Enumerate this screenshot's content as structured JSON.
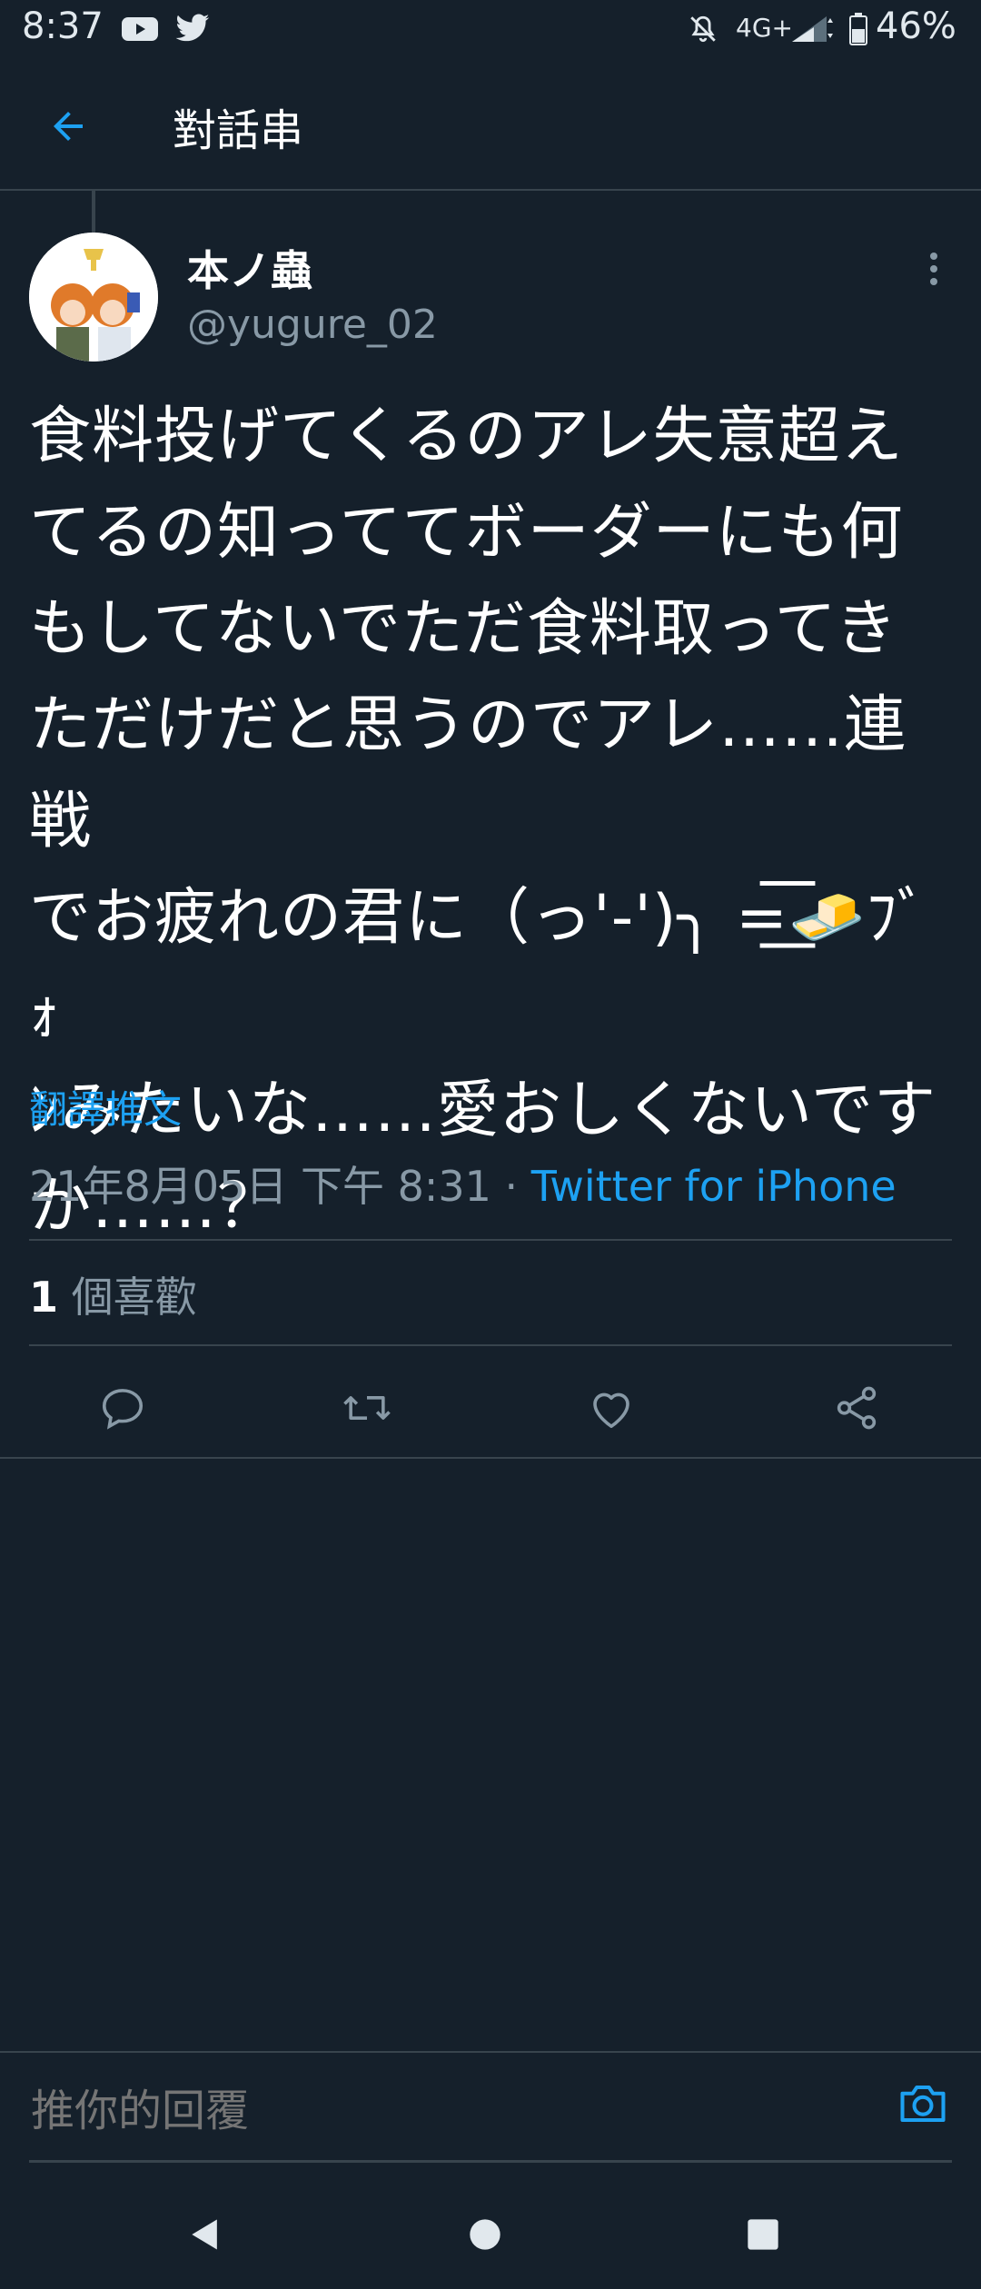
{
  "status_bar": {
    "time": "8:37",
    "network": "4G+",
    "battery": "46%",
    "icons": [
      "youtube-icon",
      "twitter-icon",
      "mute-icon",
      "signal-icon",
      "battery-icon"
    ]
  },
  "header": {
    "title": "對話串",
    "back_icon": "arrow-left-icon"
  },
  "tweet": {
    "display_name": "本ノ蟲",
    "username": "@yugure_02",
    "text": "食料投げてくるのアレ失意超え\nてるの知っててボーダーにも何\nもしてないでただ食料取ってき\nただけだと思うのでアレ……連戦\nでお疲れの君に（っ'-')╮ =͟͟͞͞🧈ﾌﾞｫ\nﾝみたいな……愛おしくないです\nか……？",
    "translate_label": "翻譯推文",
    "timestamp": "21年8月05日 下午 8:31",
    "separator": " · ",
    "source": "Twitter for iPhone",
    "likes_count": "1",
    "likes_label": " 個喜歡"
  },
  "actions": {
    "reply_icon": "reply-icon",
    "retweet_icon": "retweet-icon",
    "like_icon": "heart-icon",
    "share_icon": "share-icon"
  },
  "reply_box": {
    "placeholder": "推你的回覆",
    "camera_icon": "camera-icon"
  },
  "colors": {
    "background": "#15202b",
    "accent": "#1da1f2",
    "secondary_text": "#8899a6",
    "divider": "#38444d"
  }
}
